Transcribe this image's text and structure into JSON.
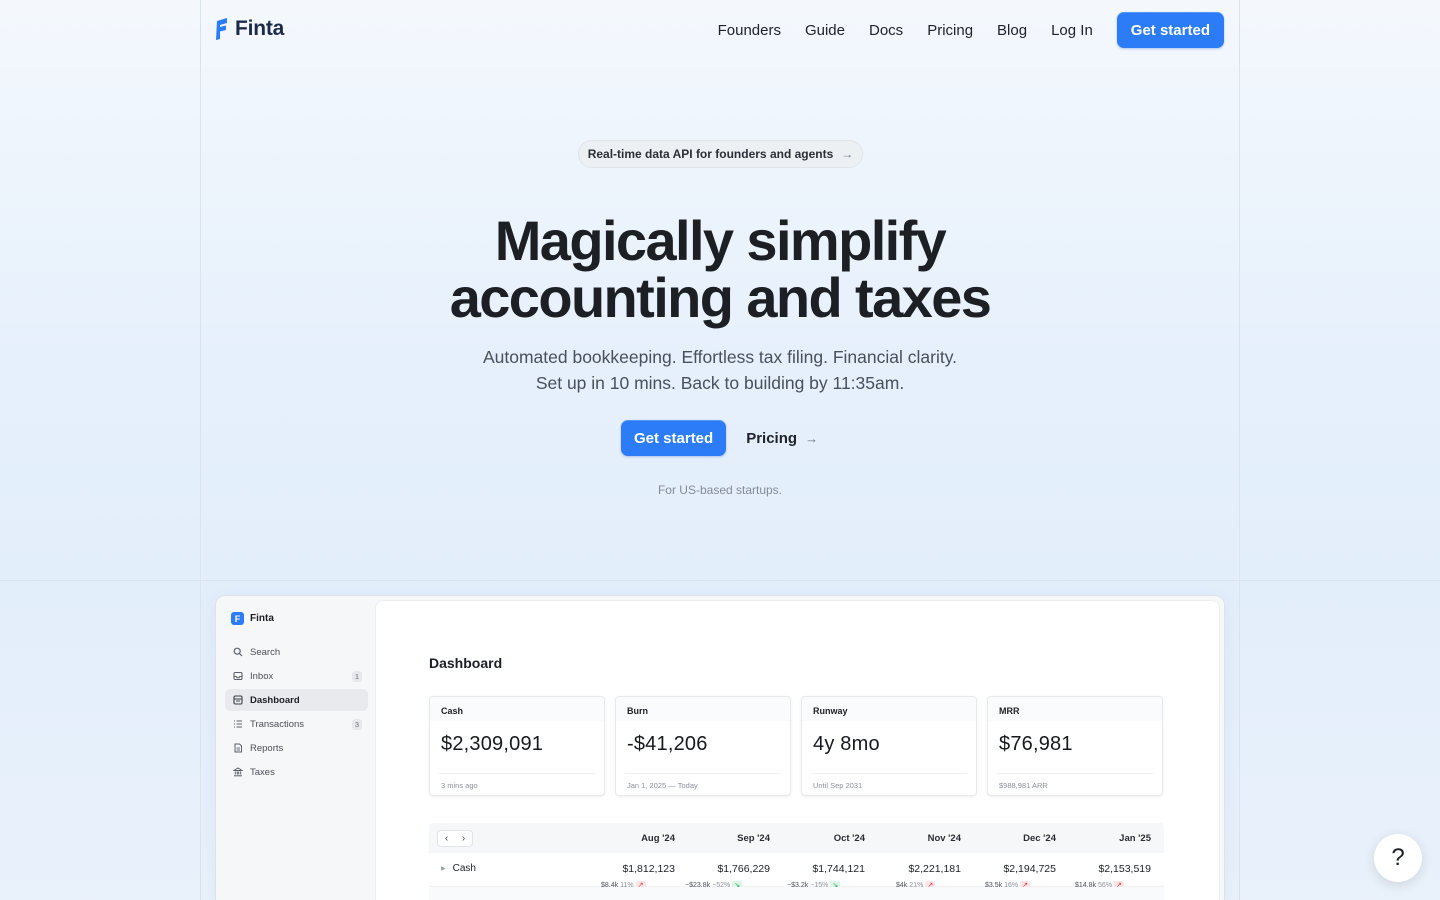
{
  "nav": {
    "logo_text": "Finta",
    "links": [
      "Founders",
      "Guide",
      "Docs",
      "Pricing",
      "Blog",
      "Log In"
    ],
    "cta": "Get started"
  },
  "hero": {
    "pill_text": "Real-time data API for founders and agents",
    "pill_arrow": "→",
    "title_line1": "Magically simplify",
    "title_line2": "accounting and taxes",
    "subtitle_line1": "Automated bookkeeping. Effortless tax filing. Financial clarity.",
    "subtitle_line2": "Set up in 10 mins. Back to building by 11:35am.",
    "primary_cta": "Get started",
    "secondary_cta": "Pricing",
    "secondary_arrow": "→",
    "fine_print": "For US-based startups."
  },
  "app": {
    "brand": "Finta",
    "brand_logo_letter": "F",
    "sidebar": [
      {
        "label": "Search",
        "icon": "search-icon",
        "badge": ""
      },
      {
        "label": "Inbox",
        "icon": "inbox-icon",
        "badge": "1"
      },
      {
        "label": "Dashboard",
        "icon": "dashboard-icon",
        "badge": "",
        "active": true
      },
      {
        "label": "Transactions",
        "icon": "list-icon",
        "badge": "3"
      },
      {
        "label": "Reports",
        "icon": "report-icon",
        "badge": ""
      },
      {
        "label": "Taxes",
        "icon": "bank-icon",
        "badge": ""
      }
    ],
    "page_title": "Dashboard",
    "cards": [
      {
        "title": "Cash",
        "value": "$2,309,091",
        "footer": "3 mins ago"
      },
      {
        "title": "Burn",
        "value": "-$41,206",
        "footer": "Jan 1, 2025 — Today"
      },
      {
        "title": "Runway",
        "value": "4y 8mo",
        "footer": "Until Sep 2031"
      },
      {
        "title": "MRR",
        "value": "$76,981",
        "footer": "$988,981 ARR"
      }
    ],
    "table": {
      "pager_prev": "‹",
      "pager_next": "›",
      "columns": [
        "Aug '24",
        "Sep '24",
        "Oct '24",
        "Nov '24",
        "Dec '24",
        "Jan '25"
      ],
      "rows": [
        {
          "label": "Cash",
          "values": [
            "$1,812,123",
            "$1,766,229",
            "$1,744,121",
            "$2,221,181",
            "$2,194,725",
            "$2,153,519"
          ],
          "deltas": [
            {
              "amount": "$8.4k",
              "pct": "11%",
              "dir": "up"
            },
            {
              "amount": "−$23.8k",
              "pct": "−52%",
              "dir": "down"
            },
            {
              "amount": "−$3.2k",
              "pct": "−15%",
              "dir": "down"
            },
            {
              "amount": "$4k",
              "pct": "21%",
              "dir": "up"
            },
            {
              "amount": "$3.5k",
              "pct": "16%",
              "dir": "up"
            },
            {
              "amount": "$14.8k",
              "pct": "56%",
              "dir": "up"
            }
          ]
        }
      ]
    }
  },
  "help_fab": "?",
  "colors": {
    "accent": "#2b7cf6",
    "text": "#1c1f24",
    "muted": "#858b94"
  }
}
